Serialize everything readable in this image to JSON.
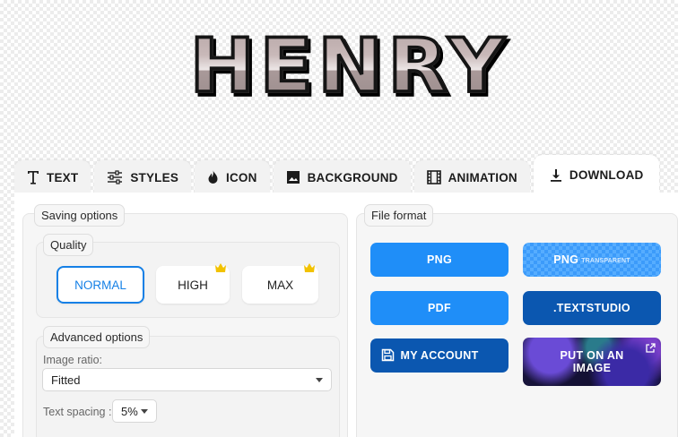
{
  "logo": {
    "text": "HENRY"
  },
  "tabs": [
    {
      "label": "TEXT",
      "icon": "text-icon"
    },
    {
      "label": "STYLES",
      "icon": "sliders-icon"
    },
    {
      "label": "ICON",
      "icon": "flame-icon"
    },
    {
      "label": "BACKGROUND",
      "icon": "image-icon"
    },
    {
      "label": "ANIMATION",
      "icon": "film-icon"
    },
    {
      "label": "DOWNLOAD",
      "icon": "download-icon",
      "active": true
    }
  ],
  "saving": {
    "title": "Saving options",
    "quality": {
      "title": "Quality",
      "options": [
        {
          "label": "NORMAL",
          "selected": true
        },
        {
          "label": "HIGH",
          "premium": true
        },
        {
          "label": "MAX",
          "premium": true
        }
      ]
    },
    "advanced": {
      "title": "Advanced options",
      "ratio_label": "Image ratio:",
      "ratio_value": "Fitted",
      "spacing_label": "Text spacing :",
      "spacing_value": "5%"
    }
  },
  "format": {
    "title": "File format",
    "png": "PNG",
    "png_transparent": "PNG",
    "png_transparent_sub": "TRANSPARENT",
    "pdf": "PDF",
    "textstudio": ".TEXTSTUDIO",
    "my_account": "MY ACCOUNT",
    "put_on_image_line1": "PUT ON AN",
    "put_on_image_line2": "IMAGE"
  },
  "colors": {
    "accent": "#1f8ef8",
    "accent_dark": "#0b57b0",
    "selected_border": "#1580e6",
    "crown": "#f2c200"
  }
}
